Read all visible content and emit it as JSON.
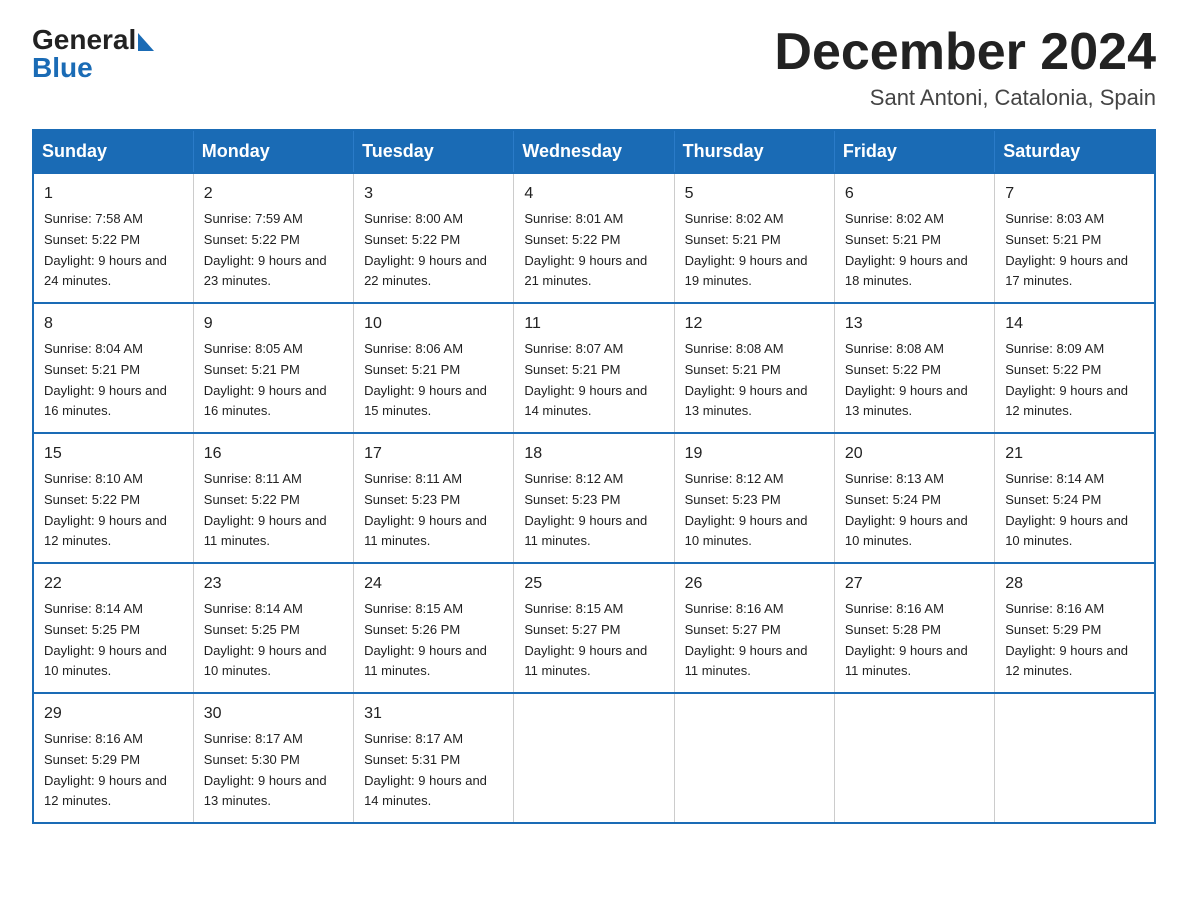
{
  "logo": {
    "general": "General",
    "blue": "Blue"
  },
  "title": "December 2024",
  "subtitle": "Sant Antoni, Catalonia, Spain",
  "headers": [
    "Sunday",
    "Monday",
    "Tuesday",
    "Wednesday",
    "Thursday",
    "Friday",
    "Saturday"
  ],
  "weeks": [
    [
      {
        "day": "1",
        "sunrise": "7:58 AM",
        "sunset": "5:22 PM",
        "daylight": "9 hours and 24 minutes."
      },
      {
        "day": "2",
        "sunrise": "7:59 AM",
        "sunset": "5:22 PM",
        "daylight": "9 hours and 23 minutes."
      },
      {
        "day": "3",
        "sunrise": "8:00 AM",
        "sunset": "5:22 PM",
        "daylight": "9 hours and 22 minutes."
      },
      {
        "day": "4",
        "sunrise": "8:01 AM",
        "sunset": "5:22 PM",
        "daylight": "9 hours and 21 minutes."
      },
      {
        "day": "5",
        "sunrise": "8:02 AM",
        "sunset": "5:21 PM",
        "daylight": "9 hours and 19 minutes."
      },
      {
        "day": "6",
        "sunrise": "8:02 AM",
        "sunset": "5:21 PM",
        "daylight": "9 hours and 18 minutes."
      },
      {
        "day": "7",
        "sunrise": "8:03 AM",
        "sunset": "5:21 PM",
        "daylight": "9 hours and 17 minutes."
      }
    ],
    [
      {
        "day": "8",
        "sunrise": "8:04 AM",
        "sunset": "5:21 PM",
        "daylight": "9 hours and 16 minutes."
      },
      {
        "day": "9",
        "sunrise": "8:05 AM",
        "sunset": "5:21 PM",
        "daylight": "9 hours and 16 minutes."
      },
      {
        "day": "10",
        "sunrise": "8:06 AM",
        "sunset": "5:21 PM",
        "daylight": "9 hours and 15 minutes."
      },
      {
        "day": "11",
        "sunrise": "8:07 AM",
        "sunset": "5:21 PM",
        "daylight": "9 hours and 14 minutes."
      },
      {
        "day": "12",
        "sunrise": "8:08 AM",
        "sunset": "5:21 PM",
        "daylight": "9 hours and 13 minutes."
      },
      {
        "day": "13",
        "sunrise": "8:08 AM",
        "sunset": "5:22 PM",
        "daylight": "9 hours and 13 minutes."
      },
      {
        "day": "14",
        "sunrise": "8:09 AM",
        "sunset": "5:22 PM",
        "daylight": "9 hours and 12 minutes."
      }
    ],
    [
      {
        "day": "15",
        "sunrise": "8:10 AM",
        "sunset": "5:22 PM",
        "daylight": "9 hours and 12 minutes."
      },
      {
        "day": "16",
        "sunrise": "8:11 AM",
        "sunset": "5:22 PM",
        "daylight": "9 hours and 11 minutes."
      },
      {
        "day": "17",
        "sunrise": "8:11 AM",
        "sunset": "5:23 PM",
        "daylight": "9 hours and 11 minutes."
      },
      {
        "day": "18",
        "sunrise": "8:12 AM",
        "sunset": "5:23 PM",
        "daylight": "9 hours and 11 minutes."
      },
      {
        "day": "19",
        "sunrise": "8:12 AM",
        "sunset": "5:23 PM",
        "daylight": "9 hours and 10 minutes."
      },
      {
        "day": "20",
        "sunrise": "8:13 AM",
        "sunset": "5:24 PM",
        "daylight": "9 hours and 10 minutes."
      },
      {
        "day": "21",
        "sunrise": "8:14 AM",
        "sunset": "5:24 PM",
        "daylight": "9 hours and 10 minutes."
      }
    ],
    [
      {
        "day": "22",
        "sunrise": "8:14 AM",
        "sunset": "5:25 PM",
        "daylight": "9 hours and 10 minutes."
      },
      {
        "day": "23",
        "sunrise": "8:14 AM",
        "sunset": "5:25 PM",
        "daylight": "9 hours and 10 minutes."
      },
      {
        "day": "24",
        "sunrise": "8:15 AM",
        "sunset": "5:26 PM",
        "daylight": "9 hours and 11 minutes."
      },
      {
        "day": "25",
        "sunrise": "8:15 AM",
        "sunset": "5:27 PM",
        "daylight": "9 hours and 11 minutes."
      },
      {
        "day": "26",
        "sunrise": "8:16 AM",
        "sunset": "5:27 PM",
        "daylight": "9 hours and 11 minutes."
      },
      {
        "day": "27",
        "sunrise": "8:16 AM",
        "sunset": "5:28 PM",
        "daylight": "9 hours and 11 minutes."
      },
      {
        "day": "28",
        "sunrise": "8:16 AM",
        "sunset": "5:29 PM",
        "daylight": "9 hours and 12 minutes."
      }
    ],
    [
      {
        "day": "29",
        "sunrise": "8:16 AM",
        "sunset": "5:29 PM",
        "daylight": "9 hours and 12 minutes."
      },
      {
        "day": "30",
        "sunrise": "8:17 AM",
        "sunset": "5:30 PM",
        "daylight": "9 hours and 13 minutes."
      },
      {
        "day": "31",
        "sunrise": "8:17 AM",
        "sunset": "5:31 PM",
        "daylight": "9 hours and 14 minutes."
      },
      null,
      null,
      null,
      null
    ]
  ]
}
